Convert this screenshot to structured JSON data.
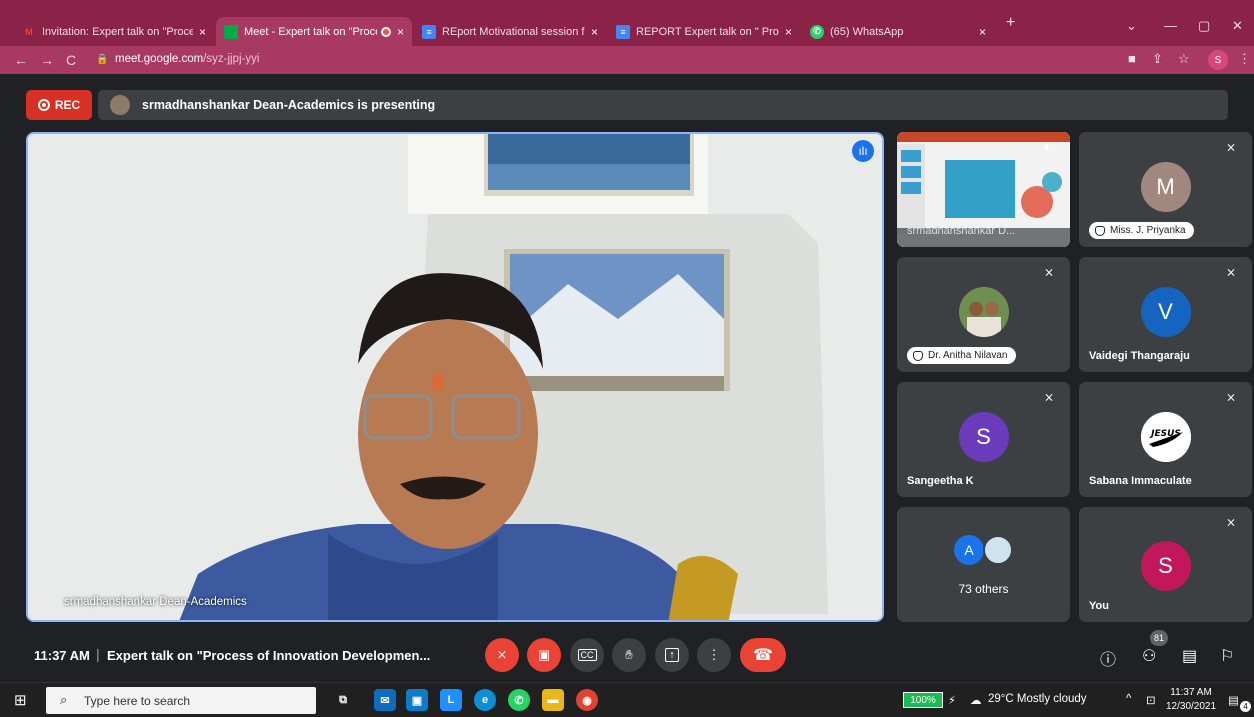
{
  "browser": {
    "tabs": [
      {
        "label": "Invitation: Expert talk on \"Proces",
        "favicon": "gmail-icon",
        "fav_glyph": "M",
        "fav_color": "#ea4335"
      },
      {
        "label": "Meet - Expert talk on \"Proce",
        "favicon": "meet-icon",
        "fav_glyph": "",
        "fav_color": "#00ac47",
        "active": true
      },
      {
        "label": "REport Motivational session for S",
        "favicon": "docs-icon",
        "fav_glyph": "≡",
        "fav_color": "#4285f4"
      },
      {
        "label": "REPORT Expert talk on \" Process",
        "favicon": "docs-icon",
        "fav_glyph": "≡",
        "fav_color": "#4285f4"
      },
      {
        "label": "(65) WhatsApp",
        "favicon": "whatsapp-icon",
        "fav_glyph": "✆",
        "fav_color": "#25d366"
      }
    ],
    "close_glyph": "×",
    "new_tab": "+",
    "url_host": "meet.google.com",
    "url_path": "/syz-jjpj-yyi",
    "profile_initial": "S"
  },
  "meet": {
    "rec_label": "REC",
    "presenting_text": "srmadhanshankar Dean-Academics is presenting",
    "main_name": "srmadhanshankar Dean-Academics",
    "tiles": {
      "presentation_name": "srmadhanshankar D...",
      "priyanka": {
        "initial": "M",
        "name": "Miss. J. Priyanka",
        "color": "#a1887f"
      },
      "anitha": {
        "name": "Dr. Anitha Nilavan"
      },
      "vaidegi": {
        "initial": "V",
        "name": "Vaidegi Thangaraju",
        "color": "#1565c0"
      },
      "sangeetha": {
        "initial": "S",
        "name": "Sangeetha K",
        "color": "#6a3cbc"
      },
      "sabana": {
        "name": "Sabana Immaculate",
        "logo_text": "JESUS"
      },
      "others": {
        "initial": "A",
        "label": "73 others",
        "color": "#1a73e8"
      },
      "you": {
        "initial": "S",
        "name": "You",
        "color": "#c2185b"
      }
    },
    "bottom": {
      "time": "11:37 AM",
      "separator": "|",
      "title": "Expert talk on \"Process of Innovation Developmen...",
      "participants_count": "81"
    }
  },
  "taskbar": {
    "search_placeholder": "Type here to search",
    "battery": "100%",
    "weather": "29°C  Mostly cloudy",
    "time": "11:37 AM",
    "date": "12/30/2021",
    "notif_count": "4"
  }
}
